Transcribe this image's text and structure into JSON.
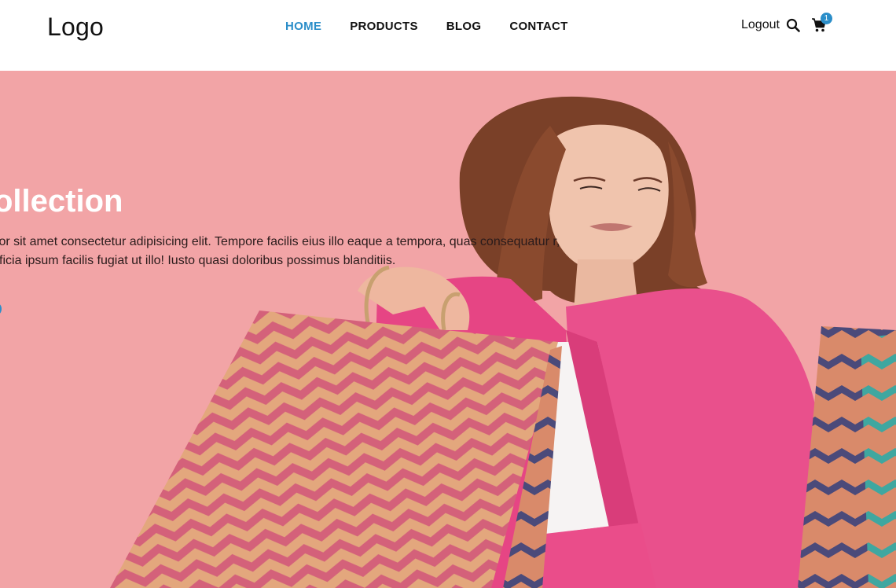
{
  "header": {
    "logo": "Logo",
    "nav": [
      {
        "label": "HOME",
        "active": true
      },
      {
        "label": "PRODUCTS",
        "active": false
      },
      {
        "label": "BLOG",
        "active": false
      },
      {
        "label": "CONTACT",
        "active": false
      }
    ],
    "logout_label": "Logout",
    "cart_count": "1",
    "icons": {
      "search": "search-icon",
      "cart": "cart-icon"
    },
    "accent_color": "#2b8ec9"
  },
  "hero": {
    "title": "ollection",
    "text": "olor sit amet consectetur adipisicing elit. Tempore facilis eius illo eaque a tempora, quas consequatur r, officia ipsum facilis fugiat ut illo! Iusto quasi doloribus possimus blanditiis.",
    "background_color": "#f2a4a6",
    "image_subject": "woman in pink blazer holding shopping bags"
  }
}
